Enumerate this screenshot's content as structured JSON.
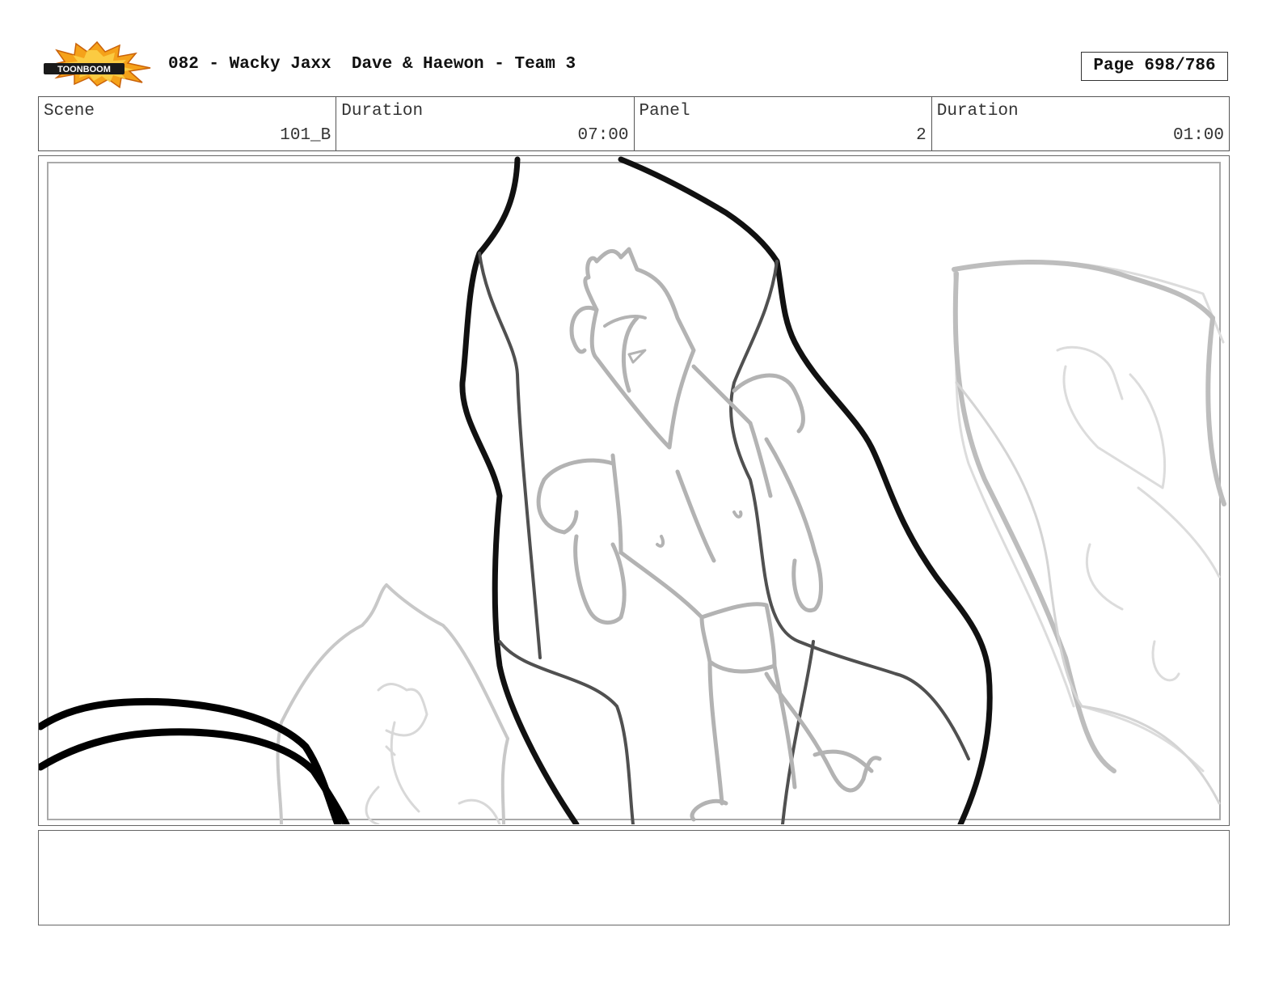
{
  "header": {
    "logo_text": "TOONBOOM",
    "title": "082 - Wacky Jaxx  Dave & Haewon - Team 3",
    "page_label": "Page 698/786"
  },
  "info_bar": {
    "scene_label": "Scene",
    "scene_value": "101_B",
    "scene_duration_label": "Duration",
    "scene_duration_value": "07:00",
    "panel_label": "Panel",
    "panel_value": "2",
    "panel_duration_label": "Duration",
    "panel_duration_value": "01:00"
  },
  "panel": {
    "image": "storyboard-sketch"
  },
  "notes": {
    "text": ""
  }
}
